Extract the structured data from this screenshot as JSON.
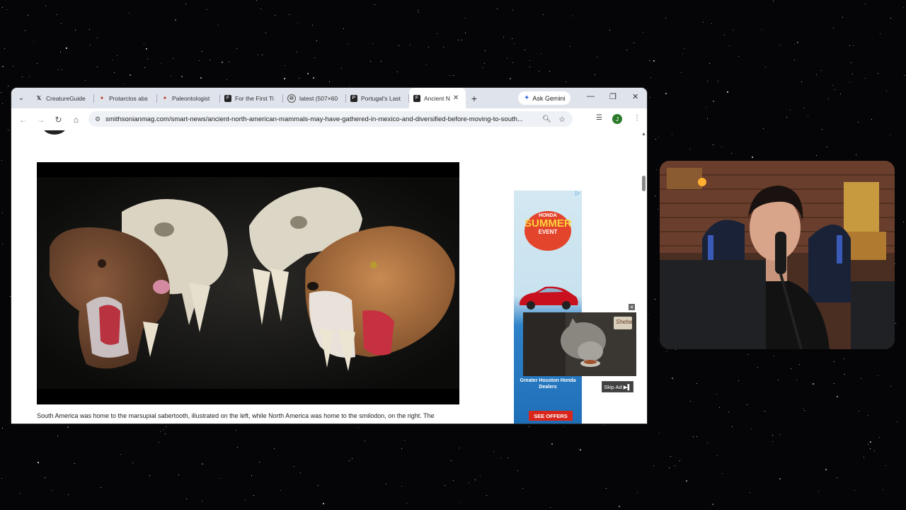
{
  "browser": {
    "tabs": [
      {
        "label": "CreatureGuide",
        "favicon": "x-logo-icon"
      },
      {
        "label": "Protarctos abs",
        "favicon": "wiki-icon"
      },
      {
        "label": "Paleontologist",
        "favicon": "wiki-icon"
      },
      {
        "label": "For the First Ti",
        "favicon": "document-icon"
      },
      {
        "label": "latest (507×60",
        "favicon": "globe-icon"
      },
      {
        "label": "Portugal's Last",
        "favicon": "document-icon"
      },
      {
        "label": "Ancient N",
        "favicon": "document-icon",
        "active": true
      }
    ],
    "new_tab": "+",
    "ask_gemini": "Ask Gemini",
    "url": "smithsonianmag.com/smart-news/ancient-north-american-mammals-may-have-gathered-in-mexico-and-diversified-before-moving-to-south...",
    "profile_initial": "J"
  },
  "article": {
    "caption": "South America was home to the marsupial sabertooth, illustrated on the left, while North America was home to the smilodon, on the right. The"
  },
  "ad": {
    "brand": "HONDA",
    "headline_1": "SUMMER",
    "headline_2": "EVENT",
    "dealer": "Greater Houston Honda Dealers",
    "cta": "SEE OFFERS",
    "overlay_brand": "Sheba",
    "skip": "Skip Ad ▶▌"
  },
  "colors": {
    "tabbar": "#dfe3eb",
    "ad_red": "#d9261c",
    "summer_badge": "#e3452c"
  }
}
